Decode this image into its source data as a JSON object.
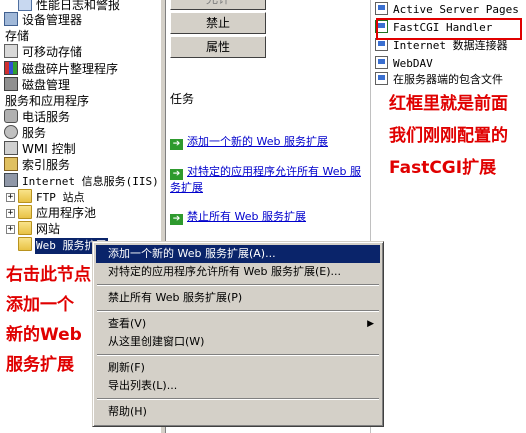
{
  "tree": {
    "items": [
      {
        "label": "性能日志和警报"
      },
      {
        "label": "设备管理器"
      },
      {
        "label": "存储"
      },
      {
        "label": "可移动存储"
      },
      {
        "label": "磁盘碎片整理程序"
      },
      {
        "label": "磁盘管理"
      },
      {
        "label": "服务和应用程序"
      },
      {
        "label": "电话服务"
      },
      {
        "label": "服务"
      },
      {
        "label": "WMI 控制"
      },
      {
        "label": "索引服务"
      },
      {
        "label": "Internet 信息服务(IIS)"
      },
      {
        "label": "FTP 站点"
      },
      {
        "label": "应用程序池"
      },
      {
        "label": "网站"
      },
      {
        "label": "Web 服务扩展"
      }
    ]
  },
  "buttons": {
    "top_partial": "允许",
    "disable": "禁止",
    "properties": "属性"
  },
  "tasks": {
    "heading": "任务",
    "items": [
      {
        "label": "添加一个新的 Web 服务扩展"
      },
      {
        "label": "对特定的应用程序允许所有 Web 服务扩展"
      },
      {
        "label": "禁止所有 Web 服务扩展"
      }
    ]
  },
  "extensions": {
    "items": [
      {
        "label": "Active Server Pages"
      },
      {
        "label": "FastCGI Handler"
      },
      {
        "label": "Internet 数据连接器"
      },
      {
        "label": "WebDAV"
      },
      {
        "label": "在服务器端的包含文件"
      }
    ]
  },
  "annotations": {
    "right": [
      "红框里就是前面",
      "我们刚刚配置的",
      "FastCGI扩展"
    ],
    "left": [
      "右击此节点",
      "添加一个",
      "新的Web",
      "服务扩展"
    ],
    "color": "#e00000"
  },
  "context_menu": {
    "items": [
      {
        "label": "添加一个新的 Web 服务扩展(A)..."
      },
      {
        "label": "对特定的应用程序允许所有 Web 服务扩展(E)..."
      },
      {
        "label": "禁止所有 Web 服务扩展(P)"
      },
      {
        "label": "查看(V)"
      },
      {
        "label": "从这里创建窗口(W)"
      },
      {
        "label": "刷新(F)"
      },
      {
        "label": "导出列表(L)..."
      },
      {
        "label": "帮助(H)"
      }
    ]
  }
}
